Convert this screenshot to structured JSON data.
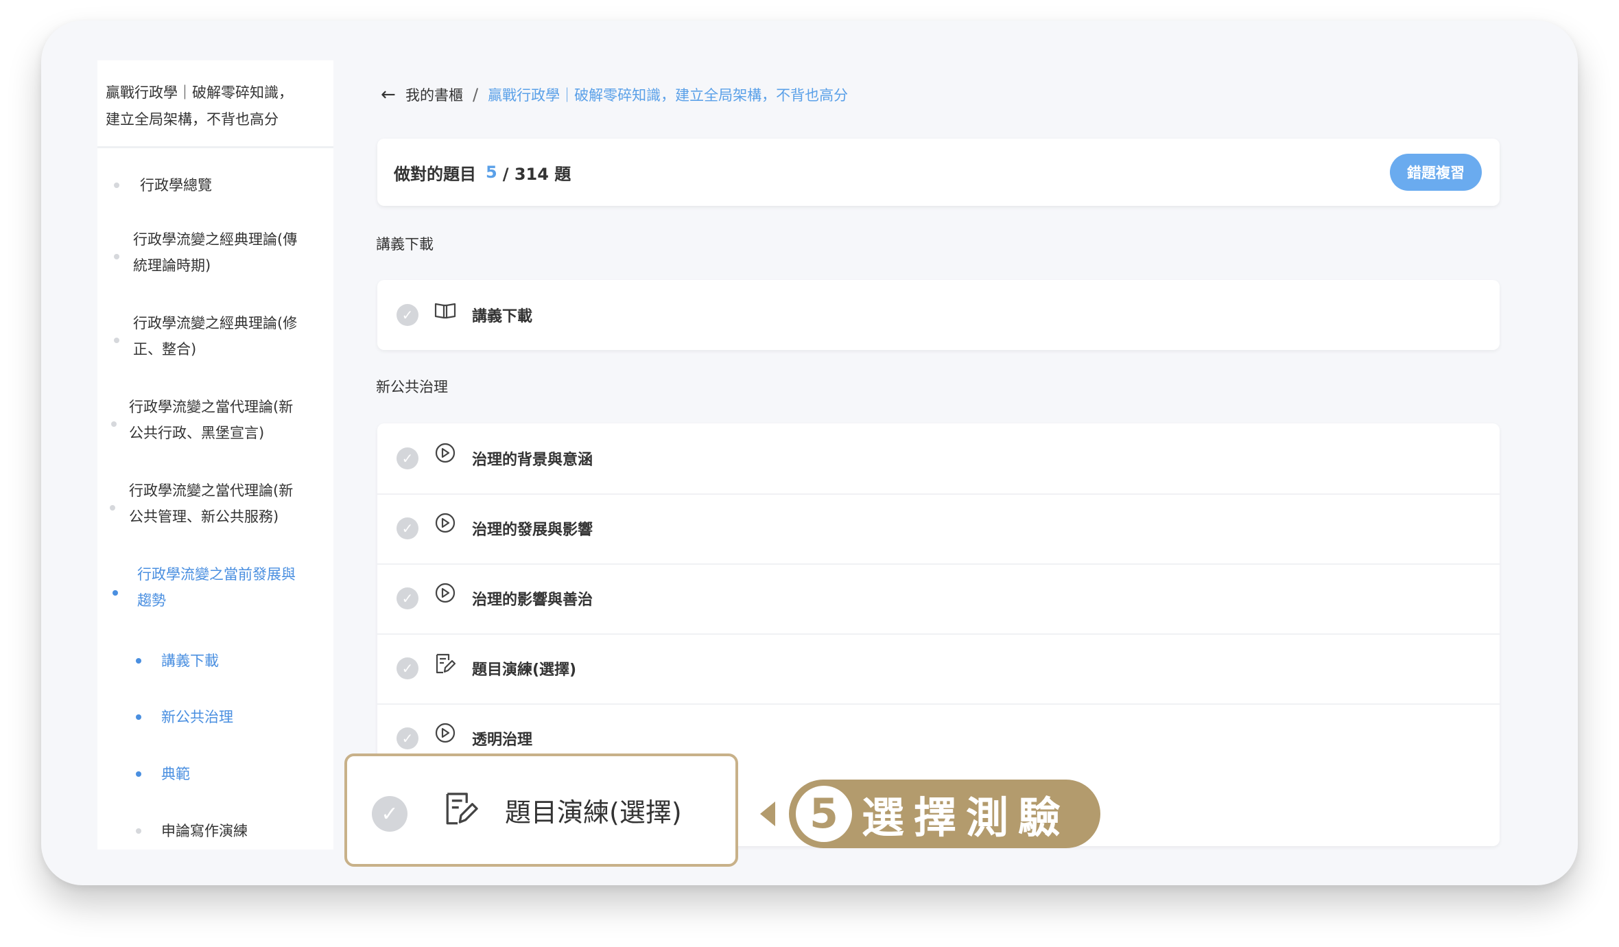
{
  "sidebar": {
    "course_title_line1": "贏戰行政學｜破解零碎知識，",
    "course_title_line2": "建立全局架構，不背也高分",
    "items": [
      {
        "line1": "行政學總覽",
        "line2": ""
      },
      {
        "line1": "行政學流變之經典理論(傳",
        "line2": "統理論時期)"
      },
      {
        "line1": "行政學流變之經典理論(修",
        "line2": "正、整合)"
      },
      {
        "line1": "行政學流變之當代理論(新",
        "line2": "公共行政、黑堡宣言)"
      },
      {
        "line1": "行政學流變之當代理論(新",
        "line2": "公共管理、新公共服務)"
      },
      {
        "line1": "行政學流變之當前發展與",
        "line2": "趨勢"
      }
    ],
    "subitems": [
      "講義下載",
      "新公共治理",
      "典範",
      "申論寫作演練"
    ]
  },
  "breadcrumb": {
    "home": "我的書櫃",
    "separator": "/",
    "current": "贏戰行政學｜破解零碎知識，建立全局架構，不背也高分"
  },
  "score": {
    "label": "做對的題目",
    "correct": "5",
    "total": "/ 314 題",
    "review_button": "錯題複習"
  },
  "sections": [
    {
      "label": "講義下載",
      "items": [
        {
          "icon": "book-open-icon",
          "title": "講義下載"
        }
      ]
    },
    {
      "label": "新公共治理",
      "items": [
        {
          "icon": "play-circle-icon",
          "title": "治理的背景與意涵"
        },
        {
          "icon": "play-circle-icon",
          "title": "治理的發展與影響"
        },
        {
          "icon": "play-circle-icon",
          "title": "治理的影響與善治"
        },
        {
          "icon": "quiz-edit-icon",
          "title": "題目演練(選擇)"
        },
        {
          "icon": "play-circle-icon",
          "title": "透明治理"
        }
      ]
    }
  ],
  "callout": {
    "title": "題目演練(選擇)",
    "step_number": "5",
    "step_label": "選擇測驗"
  },
  "colors": {
    "accent": "#4a8fe0",
    "link": "#5aa0e8",
    "button": "#6aabef",
    "callout_gold": "#b39b6d",
    "callout_border": "#c8b189",
    "check_gray": "#d4d6da"
  }
}
